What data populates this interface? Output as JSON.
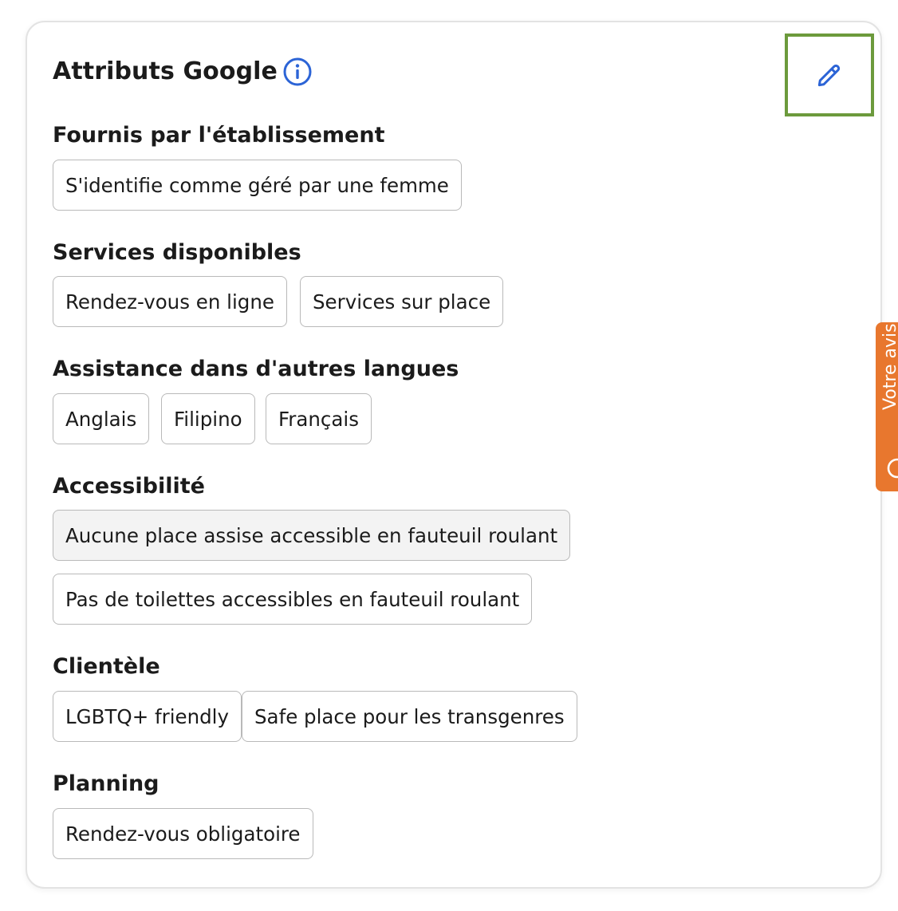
{
  "card": {
    "title": "Attributs Google",
    "info_icon": "info-icon",
    "edit_icon": "pencil-icon",
    "accent_color": "#2c64d6",
    "highlight_color": "#6c9a3c"
  },
  "sections": [
    {
      "title": "Fournis par l'établissement",
      "chips": [
        "S'identifie comme géré par une femme"
      ]
    },
    {
      "title": "Services disponibles",
      "chips": [
        "Rendez-vous en ligne",
        "Services sur place"
      ]
    },
    {
      "title": "Assistance dans d'autres langues",
      "chips": [
        "Anglais",
        "Filipino",
        "Français"
      ]
    },
    {
      "title": "Accessibilité",
      "chips": [
        "Aucune place assise accessible en fauteuil roulant",
        "Pas de toilettes accessibles en fauteuil roulant"
      ]
    },
    {
      "title": "Clientèle",
      "chips": [
        "LGBTQ+ friendly",
        "Safe place pour les transgenres"
      ]
    },
    {
      "title": "Planning",
      "chips": [
        "Rendez-vous obligatoire"
      ]
    }
  ],
  "feedback_tab": {
    "label": "Votre avis",
    "icon": "chat-bubble-icon",
    "color": "#e8772e"
  }
}
